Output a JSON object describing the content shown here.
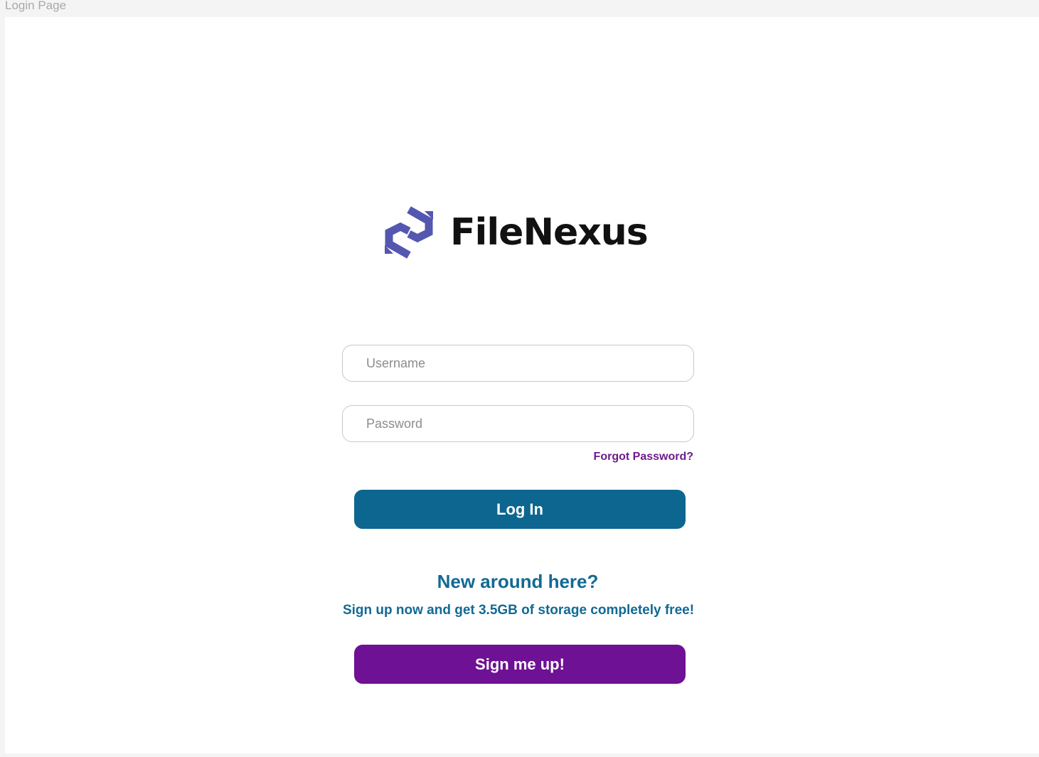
{
  "frame": {
    "label": "Login Page"
  },
  "brand": {
    "name": "FileNexus",
    "logo_icon": "hexagon-swirl-icon",
    "logo_color": "#5457b0"
  },
  "login_form": {
    "username_placeholder": "Username",
    "password_placeholder": "Password",
    "forgot_password_label": "Forgot Password?",
    "login_button_label": "Log In"
  },
  "signup": {
    "heading": "New around here?",
    "promo_text": "Sign up now and get 3.5GB of storage completely free!",
    "button_label": "Sign me up!"
  },
  "colors": {
    "primary": "#0d6690",
    "accent": "#6e1194",
    "link": "#6e1a8c",
    "text_blue": "#126994"
  }
}
